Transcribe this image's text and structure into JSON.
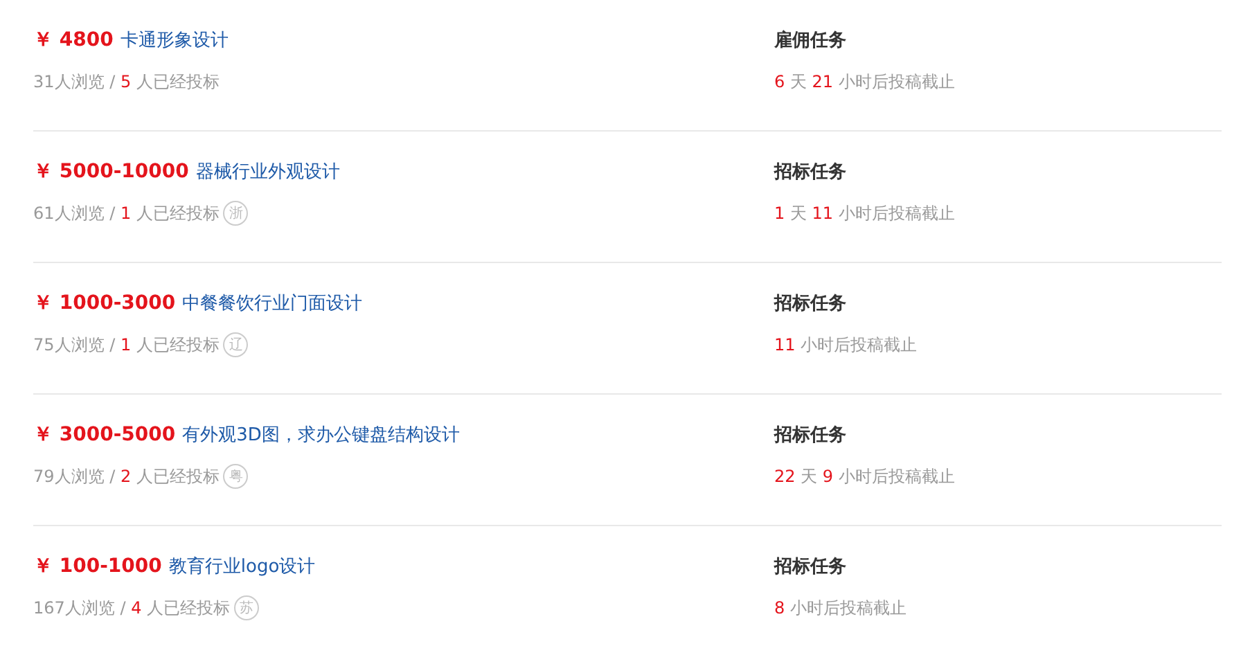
{
  "tasks": [
    {
      "price": "￥ 4800",
      "title": "卡通形象设计",
      "stats": [
        {
          "text": "31人浏览 / ",
          "highlight": false
        },
        {
          "text": "5",
          "highlight": true
        },
        {
          "text": " 人已经投标",
          "highlight": false
        }
      ],
      "type": "雇佣任务",
      "deadline": [
        {
          "text": "6",
          "highlight": true
        },
        {
          "text": " 天 ",
          "highlight": false
        },
        {
          "text": "21",
          "highlight": true
        },
        {
          "text": " 小时后投稿截止",
          "highlight": false
        }
      ]
    },
    {
      "price": "￥ 5000-10000",
      "title": "器械行业外观设计",
      "stats": [
        {
          "text": "61人浏览 / ",
          "highlight": false
        },
        {
          "text": "1",
          "highlight": true
        },
        {
          "text": " 人已经投标",
          "highlight": false
        }
      ],
      "region": "浙",
      "type": "招标任务",
      "deadline": [
        {
          "text": "1",
          "highlight": true
        },
        {
          "text": " 天 ",
          "highlight": false
        },
        {
          "text": "11",
          "highlight": true
        },
        {
          "text": " 小时后投稿截止",
          "highlight": false
        }
      ]
    },
    {
      "price": "￥ 1000-3000",
      "title": "中餐餐饮行业门面设计",
      "stats": [
        {
          "text": "75人浏览 / ",
          "highlight": false
        },
        {
          "text": "1",
          "highlight": true
        },
        {
          "text": " 人已经投标",
          "highlight": false
        }
      ],
      "region": "辽",
      "type": "招标任务",
      "deadline": [
        {
          "text": "11",
          "highlight": true
        },
        {
          "text": " 小时后投稿截止",
          "highlight": false
        }
      ]
    },
    {
      "price": "￥ 3000-5000",
      "title": "有外观3D图，求办公键盘结构设计",
      "stats": [
        {
          "text": "79人浏览 / ",
          "highlight": false
        },
        {
          "text": "2",
          "highlight": true
        },
        {
          "text": " 人已经投标",
          "highlight": false
        }
      ],
      "region": "粤",
      "type": "招标任务",
      "deadline": [
        {
          "text": "22",
          "highlight": true
        },
        {
          "text": " 天 ",
          "highlight": false
        },
        {
          "text": "9",
          "highlight": true
        },
        {
          "text": " 小时后投稿截止",
          "highlight": false
        }
      ]
    },
    {
      "price": "￥ 100-1000",
      "title": "教育行业logo设计",
      "stats": [
        {
          "text": "167人浏览 / ",
          "highlight": false
        },
        {
          "text": "4",
          "highlight": true
        },
        {
          "text": " 人已经投标",
          "highlight": false
        }
      ],
      "region": "苏",
      "type": "招标任务",
      "deadline": [
        {
          "text": "8",
          "highlight": true
        },
        {
          "text": " 小时后投稿截止",
          "highlight": false
        }
      ]
    }
  ]
}
